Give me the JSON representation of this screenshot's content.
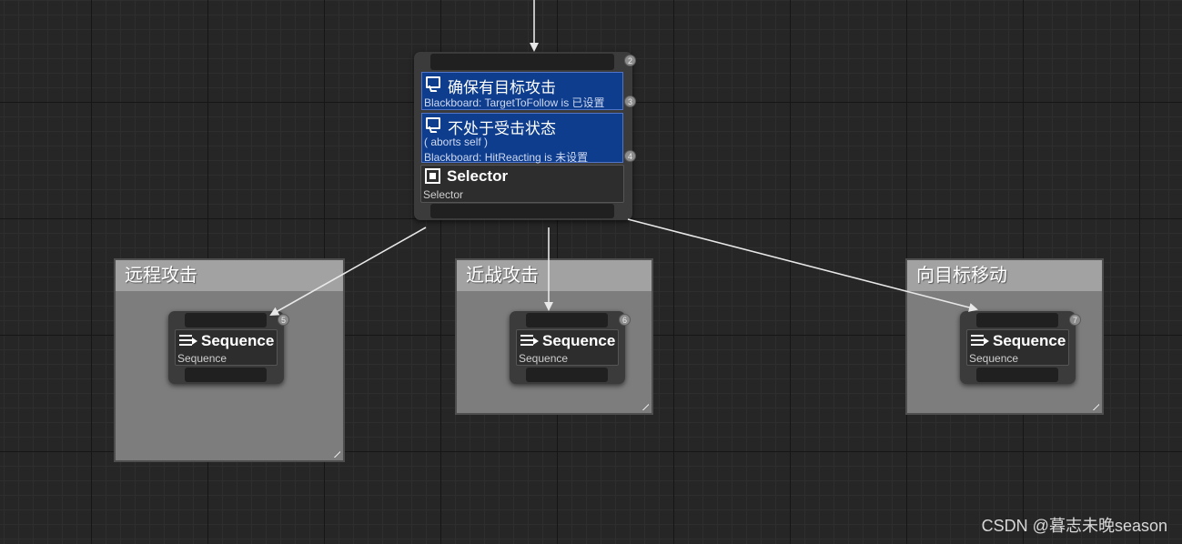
{
  "root_node": {
    "index": "2",
    "decorators": [
      {
        "index": "3",
        "title": "确保有目标攻击",
        "lines": [
          "Blackboard: TargetToFollow is 已设置"
        ]
      },
      {
        "index": "4",
        "title": "不处于受击状态",
        "lines": [
          "( aborts self )",
          "Blackboard: HitReacting is 未设置"
        ]
      }
    ],
    "composite": {
      "title": "Selector",
      "subtitle": "Selector",
      "icon": "selector-icon"
    }
  },
  "comments": [
    {
      "title": "远程攻击",
      "node": {
        "index": "5",
        "title": "Sequence",
        "subtitle": "Sequence",
        "icon": "sequence-icon"
      }
    },
    {
      "title": "近战攻击",
      "node": {
        "index": "6",
        "title": "Sequence",
        "subtitle": "Sequence",
        "icon": "sequence-icon"
      }
    },
    {
      "title": "向目标移动",
      "node": {
        "index": "7",
        "title": "Sequence",
        "subtitle": "Sequence",
        "icon": "sequence-icon"
      }
    }
  ],
  "watermark": "CSDN @暮志未晚season",
  "colors": {
    "background": "#262626",
    "decorator": "#0d3d8c",
    "node": "#3b3b3b",
    "comment_body": "#7d7d7d",
    "comment_title": "#a2a2a2",
    "wire": "#e8e8e8"
  }
}
